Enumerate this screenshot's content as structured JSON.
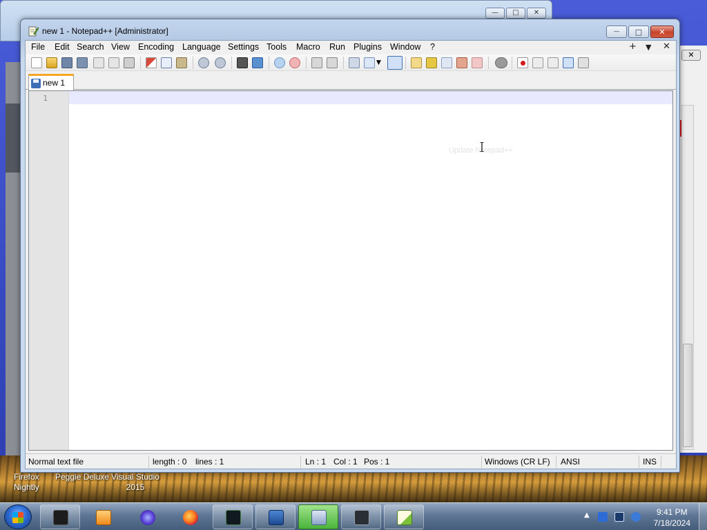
{
  "window": {
    "title": "new 1 - Notepad++ [Administrator]",
    "controls": {
      "minimize": "—",
      "maximize": "□",
      "close": "✕"
    }
  },
  "menu": {
    "items": [
      "File",
      "Edit",
      "Search",
      "View",
      "Encoding",
      "Language",
      "Settings",
      "Tools",
      "Macro",
      "Run",
      "Plugins",
      "Window",
      "?"
    ],
    "right_icons": [
      "+",
      "▼",
      "✕"
    ]
  },
  "tabs": [
    {
      "label": "new 1"
    }
  ],
  "editor": {
    "line_numbers": [
      "1"
    ],
    "ghost_text": "Update Notepad++"
  },
  "status": {
    "file_type": "Normal text file",
    "length": "length : 0",
    "lines": "lines : 1",
    "ln": "Ln : 1",
    "col": "Col : 1",
    "pos": "Pos : 1",
    "eol": "Windows (CR LF)",
    "encoding": "ANSI",
    "mode": "INS"
  },
  "desktop": {
    "icons": [
      "Firefox Nightly",
      "Peggle Deluxe",
      "Visual Studio 2015"
    ],
    "label_firefox": "Firefox",
    "label_nightly": "Nightly",
    "label_peggle": "Peggle Deluxe",
    "label_vs": "Visual Studio",
    "label_vs_year": "2015"
  },
  "background_window": {
    "controls": [
      "—",
      "□",
      "✕"
    ]
  },
  "taskbar": {
    "time": "9:41 PM",
    "date": "7/18/2024",
    "apps": [
      "terminal",
      "media-player",
      "firefox-nightly",
      "firefox",
      "task-manager",
      "remote-desktop",
      "network-connections",
      "display",
      "notepad-plus-plus"
    ]
  }
}
